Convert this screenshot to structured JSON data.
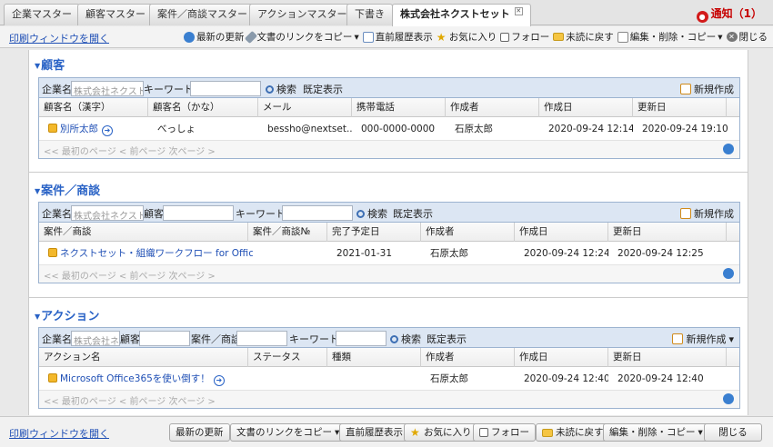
{
  "tabs": [
    {
      "label": "企業マスター"
    },
    {
      "label": "顧客マスター"
    },
    {
      "label": "案件／商談マスター"
    },
    {
      "label": "アクションマスター"
    },
    {
      "label": "下書き"
    },
    {
      "label": "株式会社ネクストセット",
      "active": true
    }
  ],
  "notification": {
    "label": "通知（1）"
  },
  "toolbar": {
    "print_link": "印刷ウィンドウを開く",
    "refresh": "最新の更新",
    "copy_link": "文書のリンクをコピー",
    "history": "直前履歴表示",
    "favorite": "お気に入り",
    "follow": "フォロー",
    "unread": "未読に戻す",
    "edit": "編集・削除・コピー",
    "close": "閉じる"
  },
  "customers": {
    "title": "顧客",
    "search": {
      "company_label": "企業名",
      "company_value": "株式会社ネクストセ",
      "keyword_label": "キーワード",
      "keyword_value": "",
      "search_label": "検索",
      "default_label": "既定表示",
      "new_label": "新規作成"
    },
    "columns": [
      "顧客名（漢字）",
      "顧客名（かな）",
      "メール",
      "携帯電話",
      "作成者",
      "作成日",
      "更新日"
    ],
    "rows": [
      {
        "name": "別所太郎",
        "kana": "べっしょ",
        "email": "bessho@nextset....",
        "mobile": "000-0000-0000",
        "creator": "石原太郎",
        "created": "2020-09-24 12:14",
        "updated": "2020-09-24 19:10"
      }
    ],
    "pager": "<< 最初のページ  < 前ページ  次ページ >"
  },
  "deals": {
    "title": "案件／商談",
    "search": {
      "company_label": "企業名",
      "company_value": "株式会社ネクストセ",
      "customer_label": "顧客",
      "customer_value": "",
      "keyword_label": "キーワード",
      "keyword_value": "",
      "search_label": "検索",
      "default_label": "既定表示",
      "new_label": "新規作成"
    },
    "columns": [
      "案件／商談",
      "案件／商談№",
      "完了予定日",
      "作成者",
      "作成日",
      "更新日"
    ],
    "rows": [
      {
        "name": "ネクストセット・組織ワークフロー for Office",
        "number": "",
        "due": "2021-01-31",
        "creator": "石原太郎",
        "created": "2020-09-24 12:24",
        "updated": "2020-09-24 12:25"
      }
    ],
    "pager": "<< 最初のページ  < 前ページ  次ページ >"
  },
  "actions": {
    "title": "アクション",
    "search": {
      "company_label": "企業名",
      "company_value": "株式会社ネク",
      "customer_label": "顧客",
      "customer_value": "",
      "deal_label": "案件／商談",
      "deal_value": "",
      "keyword_label": "キーワード",
      "keyword_value": "",
      "search_label": "検索",
      "default_label": "既定表示",
      "new_label": "新規作成"
    },
    "columns": [
      "アクション名",
      "ステータス",
      "種類",
      "作成者",
      "作成日",
      "更新日"
    ],
    "rows": [
      {
        "name": "Microsoft Office365を使い倒す！",
        "status": "",
        "type": "",
        "creator": "石原太郎",
        "created": "2020-09-24 12:40",
        "updated": "2020-09-24 12:40"
      }
    ],
    "pager": "<< 最初のページ  < 前ページ  次ページ >"
  },
  "bottom": {
    "print_link": "印刷ウィンドウを開く",
    "refresh": "最新の更新",
    "copy_link": "文書のリンクをコピー",
    "history": "直前履歴表示",
    "favorite": "お気に入り",
    "follow": "フォロー",
    "unread": "未読に戻す",
    "edit": "編集・削除・コピー",
    "close": "閉じる"
  }
}
